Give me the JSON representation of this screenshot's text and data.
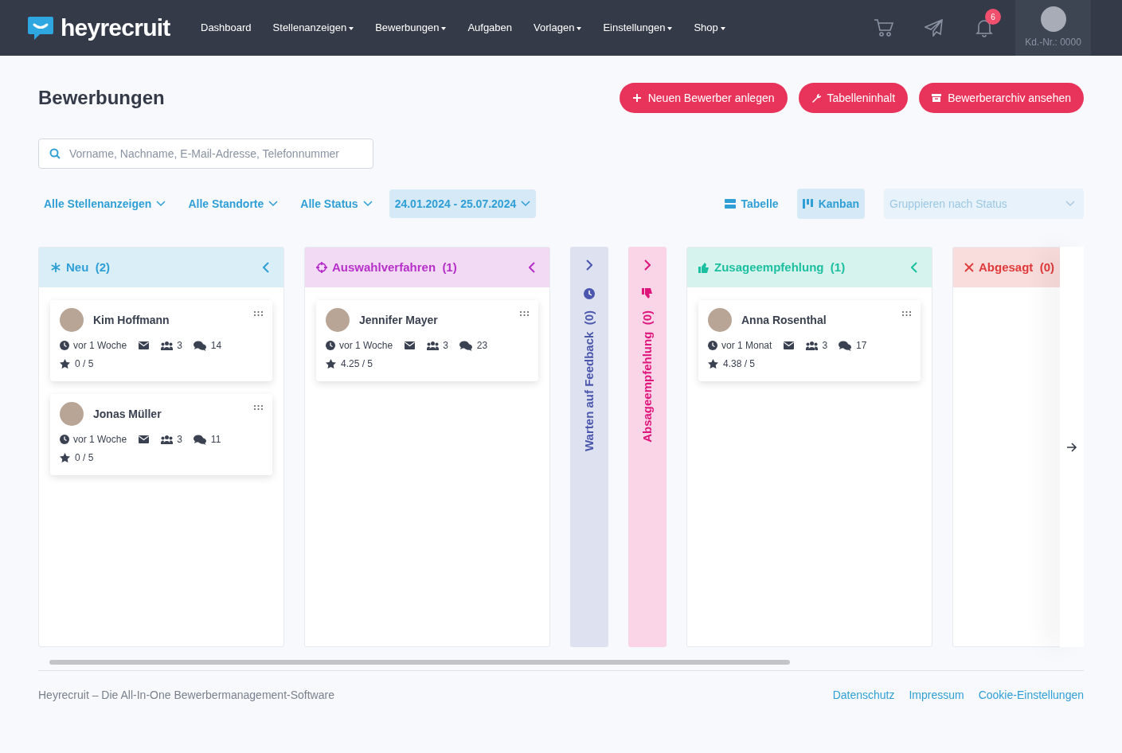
{
  "nav": {
    "logo": "heyrecruit",
    "items": [
      {
        "label": "Dashboard",
        "dropdown": false
      },
      {
        "label": "Stellenanzeigen",
        "dropdown": true
      },
      {
        "label": "Bewerbungen",
        "dropdown": true
      },
      {
        "label": "Aufgaben",
        "dropdown": false
      },
      {
        "label": "Vorlagen",
        "dropdown": true
      },
      {
        "label": "Einstellungen",
        "dropdown": true
      },
      {
        "label": "Shop",
        "dropdown": true
      }
    ],
    "notification_count": "6",
    "customer_number": "Kd.-Nr.: 0000"
  },
  "page": {
    "title": "Bewerbungen",
    "buttons": [
      {
        "label": "Neuen Bewerber anlegen",
        "kind": "plus"
      },
      {
        "label": "Tabelleninhalt",
        "kind": "wrench"
      },
      {
        "label": "Bewerberarchiv ansehen",
        "kind": "archive"
      }
    ]
  },
  "search": {
    "placeholder": "Vorname, Nachname, E-Mail-Adresse, Telefonnummer"
  },
  "filters": [
    {
      "label": "Alle Stellenanzeigen",
      "selected": false
    },
    {
      "label": "Alle Standorte",
      "selected": false
    },
    {
      "label": "Alle Status",
      "selected": false
    },
    {
      "label": "24.01.2024 - 25.07.2024",
      "selected": true
    }
  ],
  "views": [
    {
      "label": "Tabelle",
      "kind": "table",
      "selected": false
    },
    {
      "label": "Kanban",
      "kind": "kanban",
      "selected": true
    }
  ],
  "group_select": {
    "value": "Gruppieren nach Status",
    "disabled": true
  },
  "columns": [
    {
      "title": "Neu",
      "count": "(2)",
      "kind": "asterisk",
      "expanded": true,
      "color": "#2f9fd6",
      "cards": [
        {
          "name": "Kim Hoffmann",
          "time": "vor 1 Woche",
          "team": "3",
          "comments": "14",
          "rating": "0 / 5"
        },
        {
          "name": "Jonas Müller",
          "time": "vor 1 Woche",
          "team": "3",
          "comments": "11",
          "rating": "0 / 5"
        }
      ]
    },
    {
      "title": "Auswahlverfahren",
      "count": "(1)",
      "kind": "crosshair",
      "expanded": true,
      "color": "#b52fc8",
      "cards": [
        {
          "name": "Jennifer Mayer",
          "time": "vor 1 Woche",
          "team": "3",
          "comments": "23",
          "rating": "4.25 / 5"
        }
      ]
    },
    {
      "title": "Warten auf Feedback",
      "count": "(0)",
      "kind": "clock",
      "expanded": false,
      "color": "#4a57ad"
    },
    {
      "title": "Absageempfehlung",
      "count": "(0)",
      "kind": "thumbsdown",
      "expanded": false,
      "color": "#e0157c"
    },
    {
      "title": "Zusageempfehlung",
      "count": "(1)",
      "kind": "thumbsup",
      "expanded": true,
      "color": "#1cbf9f",
      "cards": [
        {
          "name": "Anna Rosenthal",
          "time": "vor 1 Monat",
          "team": "3",
          "comments": "17",
          "rating": "4.38 / 5"
        }
      ]
    },
    {
      "title": "Abgesagt",
      "count": "(0)",
      "kind": "cross",
      "expanded": true,
      "color": "#e03a3a"
    }
  ],
  "footer": {
    "text": "Heyrecruit – Die All-In-One Bewerbermanagement-Software",
    "links": [
      "Datenschutz",
      "Impressum",
      "Cookie-Einstellungen"
    ]
  }
}
